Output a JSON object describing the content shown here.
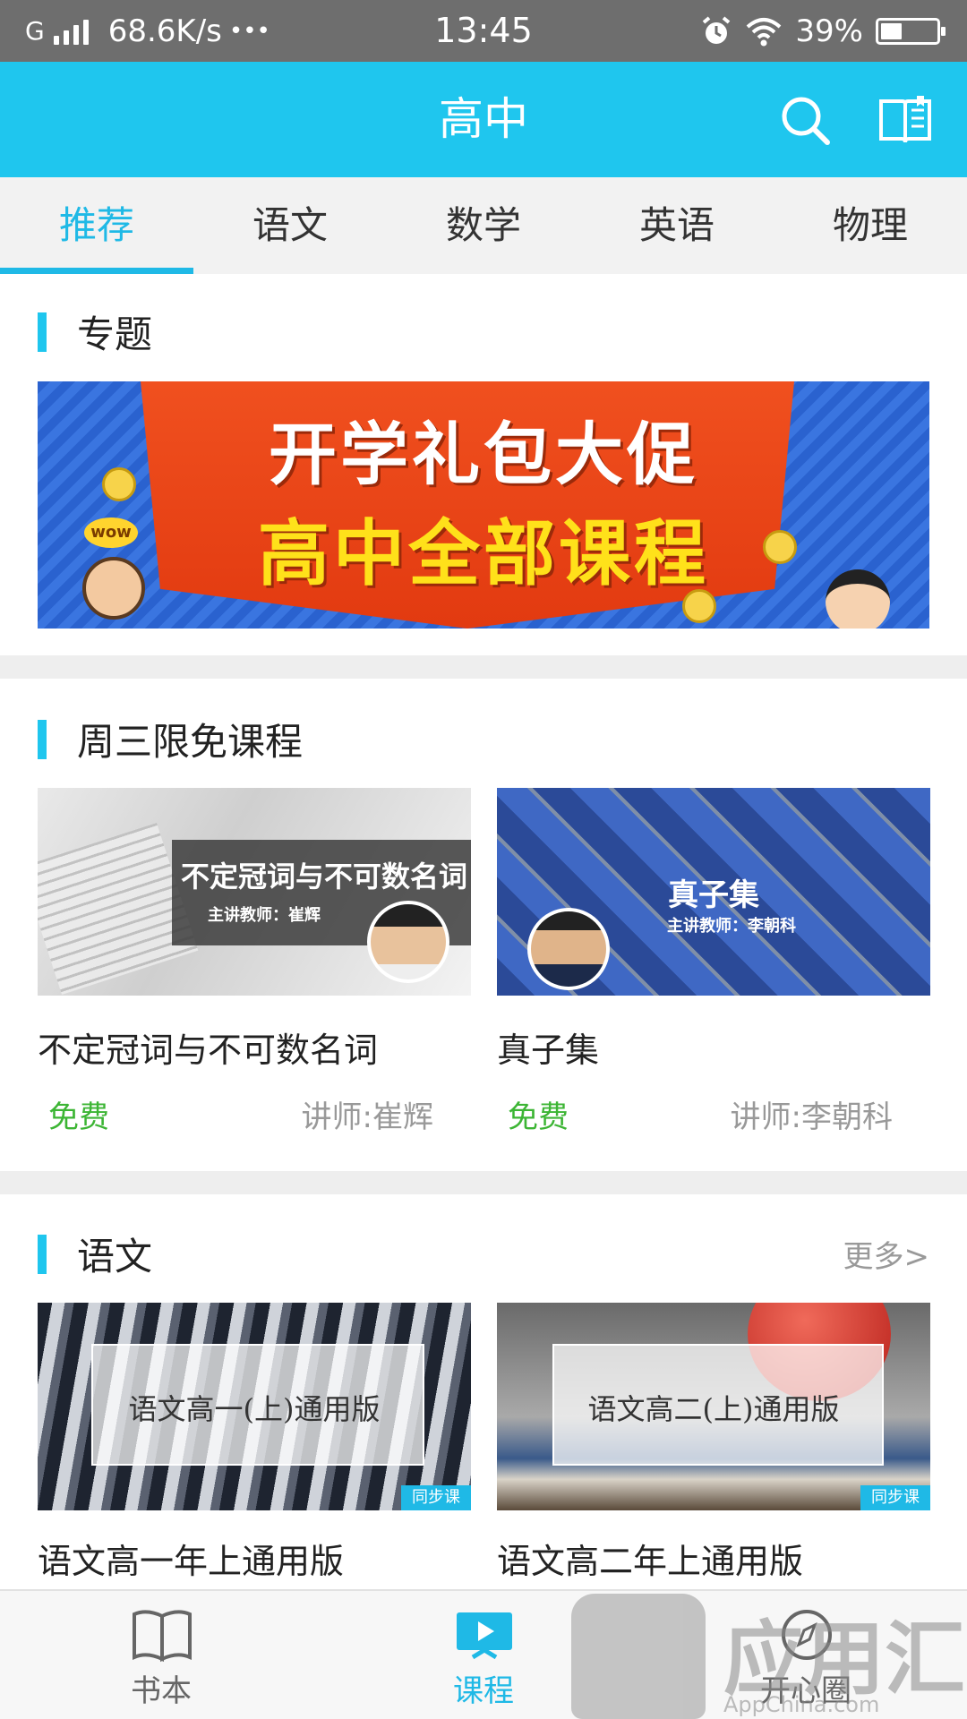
{
  "status_bar": {
    "carrier": "G",
    "net_speed": "68.6K/s",
    "dots": "•••",
    "time": "13:45",
    "battery": "39%",
    "battery_level": 0.39
  },
  "header": {
    "title": "高中",
    "search_icon": "search-icon",
    "bookshelf_icon": "book-icon"
  },
  "tabs": [
    {
      "label": "推荐",
      "active": true
    },
    {
      "label": "语文"
    },
    {
      "label": "数学"
    },
    {
      "label": "英语"
    },
    {
      "label": "物理"
    }
  ],
  "special": {
    "title": "专题",
    "banner": {
      "line1": "开学礼包大促",
      "line2": "高中全部课程",
      "badge": "wow"
    }
  },
  "free_courses": {
    "title": "周三限免课程",
    "items": [
      {
        "thumb_title": "不定冠词与不可数名词",
        "thumb_teacher": "主讲教师：崔辉",
        "name": "不定冠词与不可数名词",
        "price": "免费",
        "teacher": "讲师:崔辉"
      },
      {
        "thumb_title": "真子集",
        "thumb_teacher": "主讲教师：李朝科",
        "name": "真子集",
        "price": "免费",
        "teacher": "讲师:李朝科"
      }
    ]
  },
  "chinese": {
    "title": "语文",
    "more": "更多>",
    "items": [
      {
        "thumb_title": "语文高一(上)通用版",
        "tag": "同步课",
        "name": "语文高一年上通用版"
      },
      {
        "thumb_title": "语文高二(上)通用版",
        "tag": "同步课",
        "name": "语文高二年上通用版"
      }
    ]
  },
  "bottom_nav": [
    {
      "label": "书本",
      "icon": "book-open-icon"
    },
    {
      "label": "课程",
      "icon": "video-icon",
      "active": true
    },
    {
      "label": "开心圈",
      "icon": "compass-icon"
    }
  ],
  "watermark": {
    "text": "应用汇",
    "url": "AppChina.com"
  },
  "colors": {
    "accent": "#1fc6ee",
    "free_green": "#3cb534",
    "status_bar": "#6e6e6e"
  }
}
